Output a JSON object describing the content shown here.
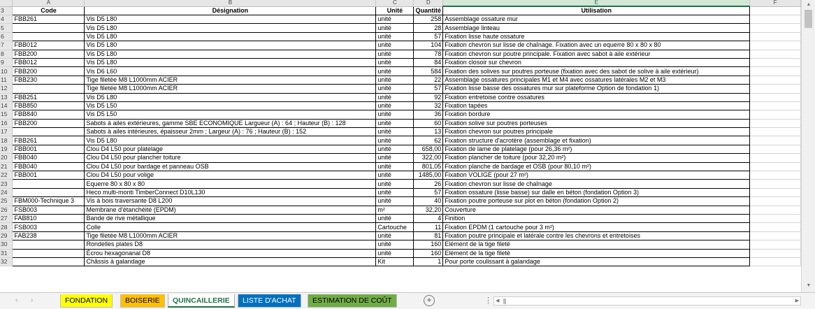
{
  "columns": [
    "A",
    "B",
    "C",
    "D",
    "E",
    "F"
  ],
  "selected_column": "E",
  "header_row": {
    "num": "3",
    "code": "Code",
    "designation": "Désignation",
    "unite": "Unité",
    "quantite": "Quantité",
    "utilisation": "Utilisation"
  },
  "rows": [
    {
      "num": "4",
      "code": "FBB261",
      "designation": "Vis D5 L80",
      "unite": "unité",
      "quantite": "258",
      "utilisation": "Assemblage ossature mur"
    },
    {
      "num": "5",
      "code": "",
      "designation": "Vis D5 L80",
      "unite": "unité",
      "quantite": "28",
      "utilisation": "Assemblage linteau"
    },
    {
      "num": "6",
      "code": "",
      "designation": "Vis D5 L80",
      "unite": "unité",
      "quantite": "57",
      "utilisation": "Fixation lisse haute ossature"
    },
    {
      "num": "7",
      "code": "FBB012",
      "designation": "Vis D5 L80",
      "unite": "unité",
      "quantite": "104",
      "utilisation": "Fixation chevron sur lisse de chaînage. Fixation avec un equerre 80 x 80 x 80"
    },
    {
      "num": "8",
      "code": "FBB200",
      "designation": "Vis D5 L80",
      "unite": "unité",
      "quantite": "78",
      "utilisation": "Fixation chevron sur poutre principale. Fixation avec sabot à aile extérieur"
    },
    {
      "num": "9",
      "code": "FBB012",
      "designation": "Vis D5 L80",
      "unite": "unité",
      "quantite": "84",
      "utilisation": "Fixation closoir sur chevron"
    },
    {
      "num": "10",
      "code": "FBB200",
      "designation": "Vis D6 L60",
      "unite": "unité",
      "quantite": "584",
      "utilisation": "Fixation des solives sur poutres porteuse (fixation avec des sabot de solive à aile extérieur)"
    },
    {
      "num": "11",
      "code": "FBB230",
      "designation": "Tige filetée M8 L1000mm ACIER",
      "unite": "unité",
      "quantite": "22",
      "utilisation": "Assemblage ossatures principales M1 et M4 avec ossatures latérales M2 et M3"
    },
    {
      "num": "12",
      "code": "",
      "designation": "Tige filetée M8 L1000mm ACIER",
      "unite": "unité",
      "quantite": "57",
      "utilisation": "Fixation lisse basse des ossatures mur sur plateforme Option de fondation 1)"
    },
    {
      "num": "13",
      "code": "FBB251",
      "designation": "Vis D5 L80",
      "unite": "unité",
      "quantite": "92",
      "utilisation": "Fixation entretoise contre ossatures"
    },
    {
      "num": "14",
      "code": "FBB850",
      "designation": "Vis D5 L50",
      "unite": "unité",
      "quantite": "32",
      "utilisation": "Fixation tapées"
    },
    {
      "num": "15",
      "code": "FBB840",
      "designation": "Vis D5 L50",
      "unite": "unité",
      "quantite": "36",
      "utilisation": "Fixation bordure"
    },
    {
      "num": "16",
      "code": "FBB200",
      "designation": "Sabots à ailes extérieures, gamme SBE ECONOMIQUE Largueur (A) : 64 ; Hauteur (B) : 128",
      "unite": "unité",
      "quantite": "60",
      "utilisation": "Fixation solive sur poutres porteuses"
    },
    {
      "num": "17",
      "code": "",
      "designation": "Sabots à ailes intérieures, épaisseur 2mm ; Largeur (A) : 76 ; Hauteur (B) : 152",
      "unite": "unité",
      "quantite": "13",
      "utilisation": "Fixation chevron sur poutres principale"
    },
    {
      "num": "18",
      "code": "FBB261",
      "designation": "Vis D5 L80",
      "unite": "unité",
      "quantite": "62",
      "utilisation": "Fixation structure d'acrotère (assemblage et fixation)"
    },
    {
      "num": "19",
      "code": "FBB001",
      "designation": "Clou D4 L50 pour platelage",
      "unite": "unité",
      "quantite": "658,00",
      "utilisation": "Fixation de lame de platelage (pour 26,36 m²)"
    },
    {
      "num": "20",
      "code": "FBB040",
      "designation": "Clou D4 L50 pour plancher toiture",
      "unite": "unité",
      "quantite": "322,00",
      "utilisation": "Fixation plancher de toiture (pour 32,20 m²)"
    },
    {
      "num": "21",
      "code": "FBB040",
      "designation": "Clou D4 L50 pour bardage et panneau OSB",
      "unite": "unité",
      "quantite": "801,05",
      "utilisation": "Fixation planche de bardage et OSB (pour 80,10 m²)"
    },
    {
      "num": "22",
      "code": "FBB001",
      "designation": "Clou D4 L50 pour volige",
      "unite": "unité",
      "quantite": "1485,00",
      "utilisation": "Fixation VOLIGE (pour 27 m²)"
    },
    {
      "num": "23",
      "code": "",
      "designation": "Equerre 80 x 80 x 80",
      "unite": "unité",
      "quantite": "26",
      "utilisation": "Fixation chevron sur lisse de chaînage"
    },
    {
      "num": "24",
      "code": "",
      "designation": "Heco multi-monti TimberConnect D10L130",
      "unite": "unité",
      "quantite": "57",
      "utilisation": "Fixation ossature (lisse basse) sur dalle en béton (fondation Option 3)"
    },
    {
      "num": "25",
      "code": "FBM000-Technique 3",
      "designation": "Vis à bois traversante D8 L200",
      "unite": "unité",
      "quantite": "40",
      "utilisation": "Fixation poutre porteuse sur plot en béton (fondation Option 2)"
    },
    {
      "num": "26",
      "code": "FSB003",
      "designation": "Membrane d'étanchéité (EPDM)",
      "unite": "m²",
      "quantite": "32,20",
      "utilisation": "Couverture"
    },
    {
      "num": "27",
      "code": "FAB810",
      "designation": "Bande de rive métallique",
      "unite": "unité",
      "quantite": "4",
      "utilisation": "Finition"
    },
    {
      "num": "28",
      "code": "FSB003",
      "designation": "Colle",
      "unite": "Cartouche",
      "quantite": "11",
      "utilisation": "Fixation EPDM (1 cartouche pour 3 m²)"
    },
    {
      "num": "29",
      "code": "FAB238",
      "designation": "Tige filetée M8 L1000mm ACIER",
      "unite": "unité",
      "quantite": "81",
      "utilisation": "Fixation poutre principale et latérale contre les chevrons et entretoises"
    },
    {
      "num": "30",
      "code": "",
      "designation": "Rondelles plates D8",
      "unite": "unité",
      "quantite": "160",
      "utilisation": "Elément de la tige fileté"
    },
    {
      "num": "31",
      "code": "",
      "designation": "Écrou hexagonanal D8",
      "unite": "unité",
      "quantite": "160",
      "utilisation": "Elément de la tige fileté"
    },
    {
      "num": "32",
      "code": "",
      "designation": "Châssis à galandage",
      "unite": "Kit",
      "quantite": "1",
      "utilisation": "Pour porte coulissant à galandage"
    }
  ],
  "tabs": [
    {
      "label": "FONDATION",
      "bg": "#ffff00",
      "color": "#000000",
      "active": false
    },
    {
      "label": "BOISERIE",
      "bg": "#ffc000",
      "color": "#000000",
      "active": false
    },
    {
      "label": "QUINCAILLERIE",
      "bg": "#ffffff",
      "color": "#217346",
      "active": true
    },
    {
      "label": "LISTE D'ACHAT",
      "bg": "#0070c0",
      "color": "#ffffff",
      "active": false
    },
    {
      "label": "ESTIMATION DE COÛT",
      "bg": "#70ad47",
      "color": "#000000",
      "active": false
    }
  ],
  "accent_color": "#217346",
  "icons": {
    "nav_prev": "chevron-left-icon",
    "nav_next": "chevron-right-icon",
    "add": "plus-circle-icon",
    "more": "vertical-ellipsis-icon"
  }
}
